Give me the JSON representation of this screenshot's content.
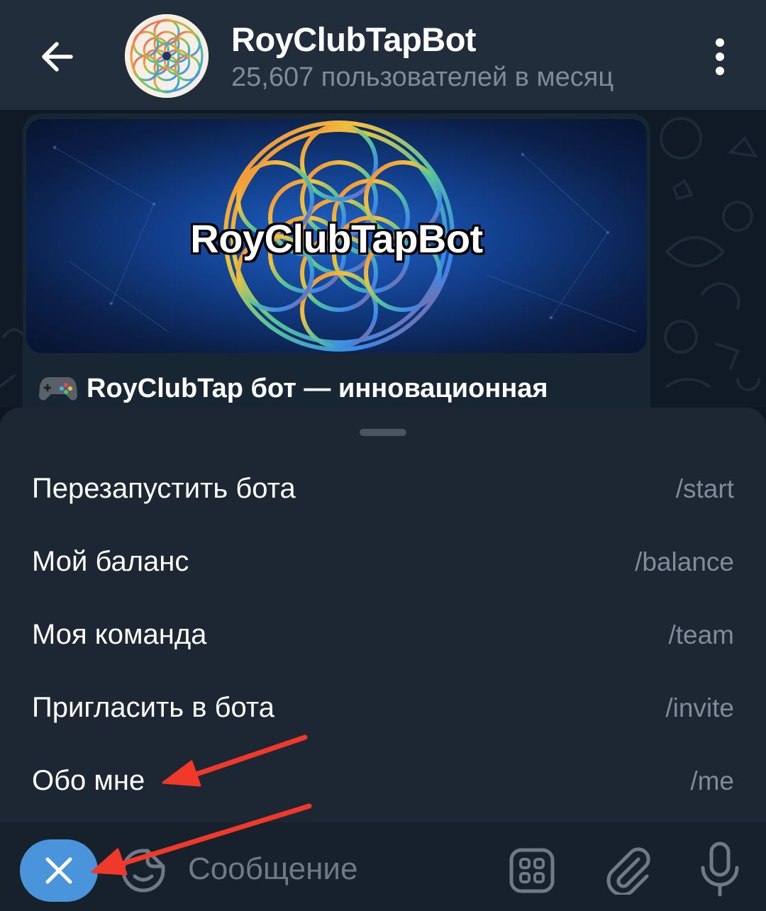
{
  "header": {
    "back_icon": "arrow-left-icon",
    "avatar_icon": "flower-of-life-logo",
    "title": "RoyClubTapBot",
    "subtitle": "25,607 пользователей в месяц",
    "menu_icon": "more-vertical-icon"
  },
  "message": {
    "banner_title": "RoyClubTapBot",
    "caption_icon": "game-controller-icon",
    "caption": "RoyClubTap бот — инновационная"
  },
  "commands": [
    {
      "label": "Перезапустить бота",
      "command": "/start"
    },
    {
      "label": "Мой баланс",
      "command": "/balance"
    },
    {
      "label": "Моя команда",
      "command": "/team"
    },
    {
      "label": "Пригласить в бота",
      "command": "/invite"
    },
    {
      "label": "Обо мне",
      "command": "/me"
    }
  ],
  "input": {
    "close_icon": "close-icon",
    "sticker_icon": "sticker-icon",
    "placeholder": "Сообщение",
    "commands_icon": "bot-commands-icon",
    "attach_icon": "paperclip-icon",
    "mic_icon": "microphone-icon"
  },
  "colors": {
    "header_bg": "#212d3b",
    "sheet_bg": "#1d2733",
    "input_bg": "#17212b",
    "accent": "#4a94dc",
    "secondary_text": "#7f8b98",
    "annotation": "#f0392b"
  }
}
